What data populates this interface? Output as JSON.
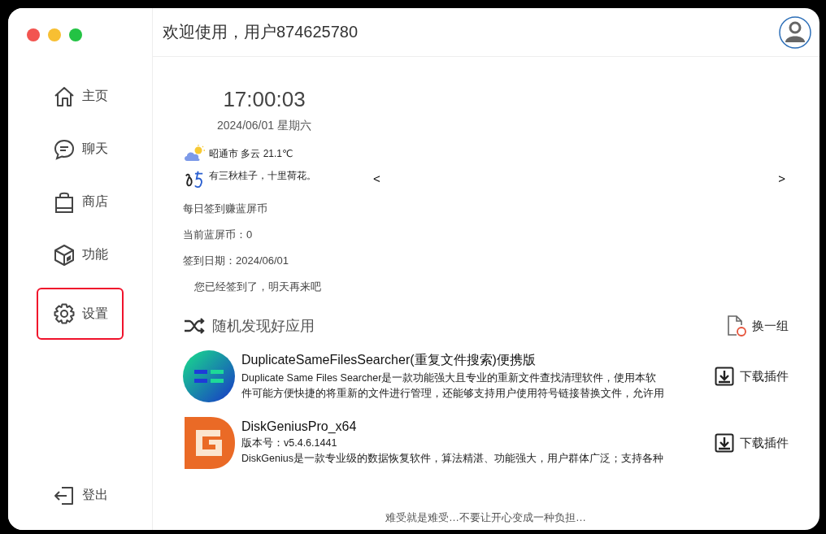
{
  "header": {
    "greeting": "欢迎使用，用户874625780"
  },
  "sidebar": {
    "items": [
      {
        "label": "主页",
        "kind": "home",
        "selected": false
      },
      {
        "label": "聊天",
        "kind": "chat",
        "selected": false
      },
      {
        "label": "商店",
        "kind": "shop",
        "selected": false
      },
      {
        "label": "功能",
        "kind": "features",
        "selected": false
      },
      {
        "label": "设置",
        "kind": "settings",
        "selected": true
      }
    ],
    "logout": "登出"
  },
  "clock": {
    "time": "17:00:03",
    "date": "2024/06/01 星期六"
  },
  "weather": {
    "text": "昭通市 多云 21.1℃"
  },
  "poem": {
    "text": "有三秋桂子，十里荷花。"
  },
  "checkin": {
    "title": "每日签到赚蓝屏币",
    "balance": "当前蓝屏币：0",
    "date": "签到日期：2024/06/01",
    "status": "您已经签到了，明天再来吧"
  },
  "carousel": {
    "prev": "<",
    "next": ">"
  },
  "apps": {
    "title": "随机发现好应用",
    "refresh": "换一组",
    "items": [
      {
        "name": "DuplicateSameFilesSearcher(重复文件搜索)便携版",
        "kind": "dup",
        "lines": [
          "Duplicate Same Files Searcher是一款功能强大且专业的重新文件查找清理软件，使用本软",
          "件可能方便快捷的将重新的文件进行管理，还能够支持用户使用符号链接替换文件，允许用"
        ],
        "action": "下载插件"
      },
      {
        "name": "DiskGeniusPro_x64",
        "kind": "disk",
        "lines": [
          "版本号：v5.4.6.1441",
          "DiskGenius是一款专业级的数据恢复软件，算法精湛、功能强大，用户群体广泛；支持各种"
        ],
        "action": "下载插件"
      }
    ]
  },
  "footer": "难受就是难受…不要让开心变成一种负担…"
}
